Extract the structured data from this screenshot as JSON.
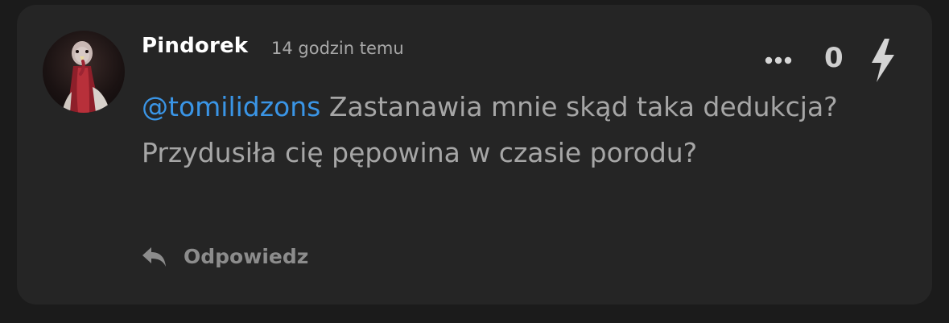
{
  "comment": {
    "author": "Pindorek",
    "timestamp": "14 godzin temu",
    "score": "0",
    "mention": "@tomilidzons",
    "text": " Zastanawia mnie skąd taka dedukcja? Przydusiła cię pępowina w czasie porodu?",
    "reply_label": "Odpowiedz"
  },
  "icons": {
    "more": "more-horizontal-icon",
    "vote": "lightning-bolt-icon",
    "reply": "reply-arrow-icon",
    "avatar": "turkey-avatar"
  },
  "colors": {
    "background": "#1b1b1b",
    "card": "#252525",
    "mention": "#3a95e6",
    "text": "#a6a6a6"
  }
}
